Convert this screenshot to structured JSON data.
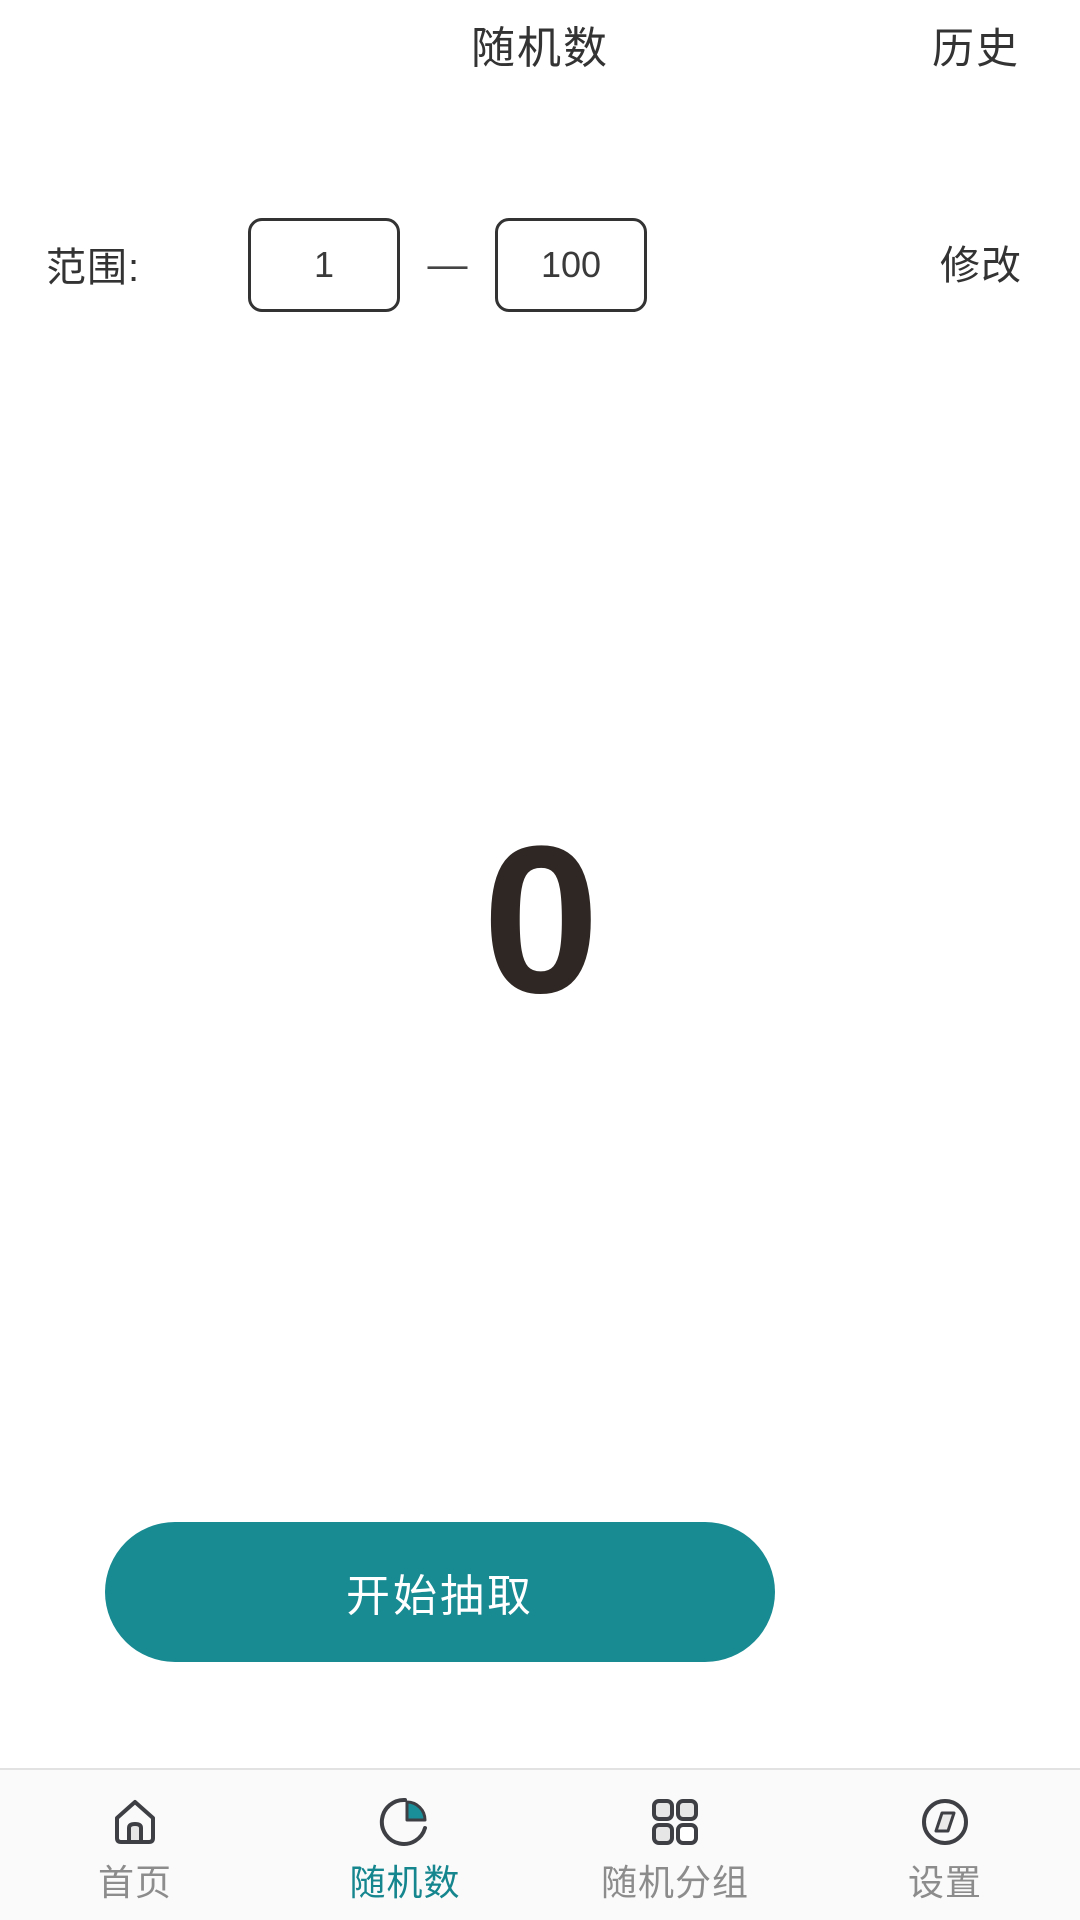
{
  "colors": {
    "accent": "#188a92",
    "accent_text": "#15858e",
    "text_primary": "#333333",
    "result_text": "#2f2723",
    "tab_inactive": "#8c8c8c",
    "border": "#333333",
    "tabbar_bg": "#fafafa"
  },
  "header": {
    "title": "随机数",
    "action_label": "历史"
  },
  "range": {
    "label": "范围:",
    "min_value": "1",
    "max_value": "100",
    "min_placeholder": "1",
    "max_placeholder": "100",
    "separator": "—",
    "edit_label": "修改"
  },
  "result": {
    "value": "0"
  },
  "action": {
    "label": "开始抽取"
  },
  "tabbar": {
    "items": [
      {
        "label": "首页",
        "icon": "home-icon",
        "active": false
      },
      {
        "label": "随机数",
        "icon": "pie-chart-icon",
        "active": true
      },
      {
        "label": "随机分组",
        "icon": "grid-icon",
        "active": false
      },
      {
        "label": "设置",
        "icon": "compass-icon",
        "active": false
      }
    ]
  }
}
